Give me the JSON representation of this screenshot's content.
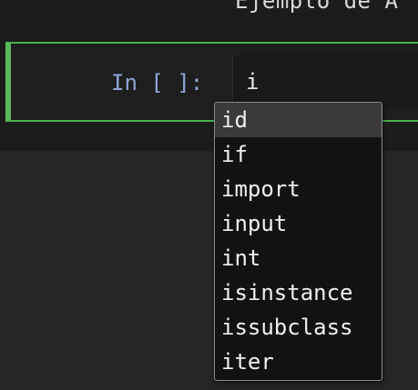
{
  "header": {
    "partial_text": "Ejemplo de A"
  },
  "cell": {
    "prompt": "In [ ]:",
    "input_value": "i"
  },
  "autocomplete": {
    "selected_index": 0,
    "items": [
      "id",
      "if",
      "import",
      "input",
      "int",
      "isinstance",
      "issubclass",
      "iter"
    ]
  },
  "colors": {
    "cell_border": "#5cb85c",
    "prompt_text": "#8fa5d6",
    "selected_item_bg": "#3a3a3a"
  }
}
